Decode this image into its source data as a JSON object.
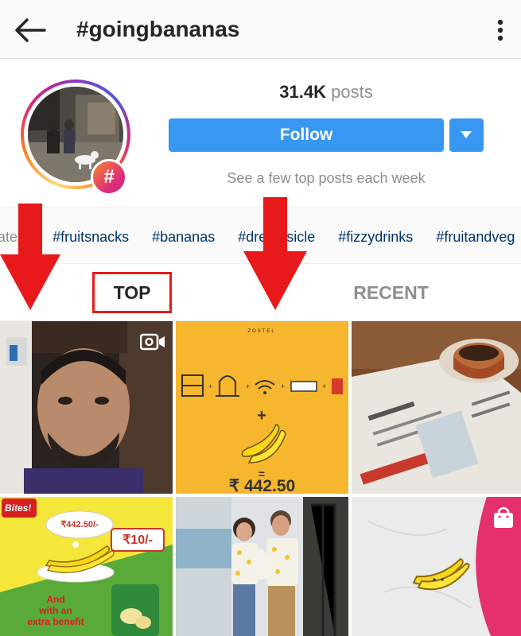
{
  "header": {
    "title": "#goingbananas",
    "back_icon": "arrow-left-icon",
    "more_icon": "more-vertical-icon"
  },
  "profile": {
    "badge_symbol": "#",
    "posts_count": "31.4K",
    "posts_label": "posts",
    "follow_label": "Follow",
    "subtext": "See a few top posts each week"
  },
  "related": {
    "label": "Related:",
    "tags": [
      "#fruitsnacks",
      "#bananas",
      "#dreamsicle",
      "#fizzydrinks",
      "#fruitandveg"
    ]
  },
  "tabs": {
    "top": "TOP",
    "recent": "RECENT"
  },
  "grid": {
    "tile2_price": "₹ 442.50",
    "tile4_brand": "Bites!",
    "tile4_price_bubble": "₹442.50/-",
    "tile4_price_tag": "₹10/-",
    "tile4_caption_line1": "And",
    "tile4_caption_line2": "with an",
    "tile4_caption_line3": "extra benefit"
  },
  "colors": {
    "accent_blue": "#3897f0",
    "annotation_red": "#e8191b",
    "tag_link": "#003569"
  }
}
